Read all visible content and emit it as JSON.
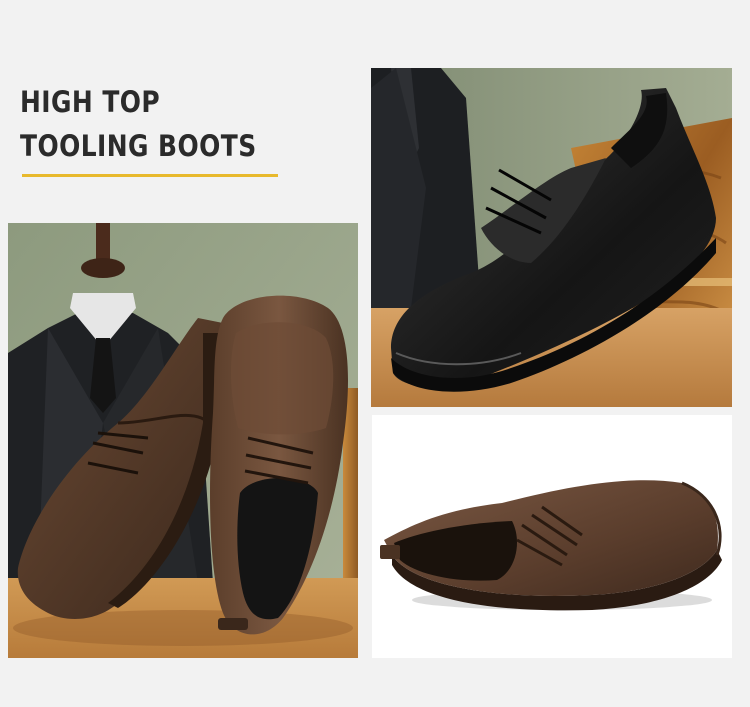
{
  "headline": {
    "line1": "HIGH TOP",
    "line2": "TOOLING BOOTS"
  },
  "colors": {
    "background": "#f2f2f2",
    "accent_underline": "#e8b92c",
    "headline_text": "#2b2b2b",
    "photo_backdrop_green": "#9aa68a",
    "brown_leather": "#4a3426",
    "black_leather": "#1a1a1a",
    "wood": "#b87a36"
  },
  "images": {
    "left": "brown-leather-shoes-with-suit-mannequin-photo",
    "top_right": "black-leather-shoe-on-wood-box-photo",
    "bottom_right": "brown-leather-shoe-on-white-photo"
  }
}
